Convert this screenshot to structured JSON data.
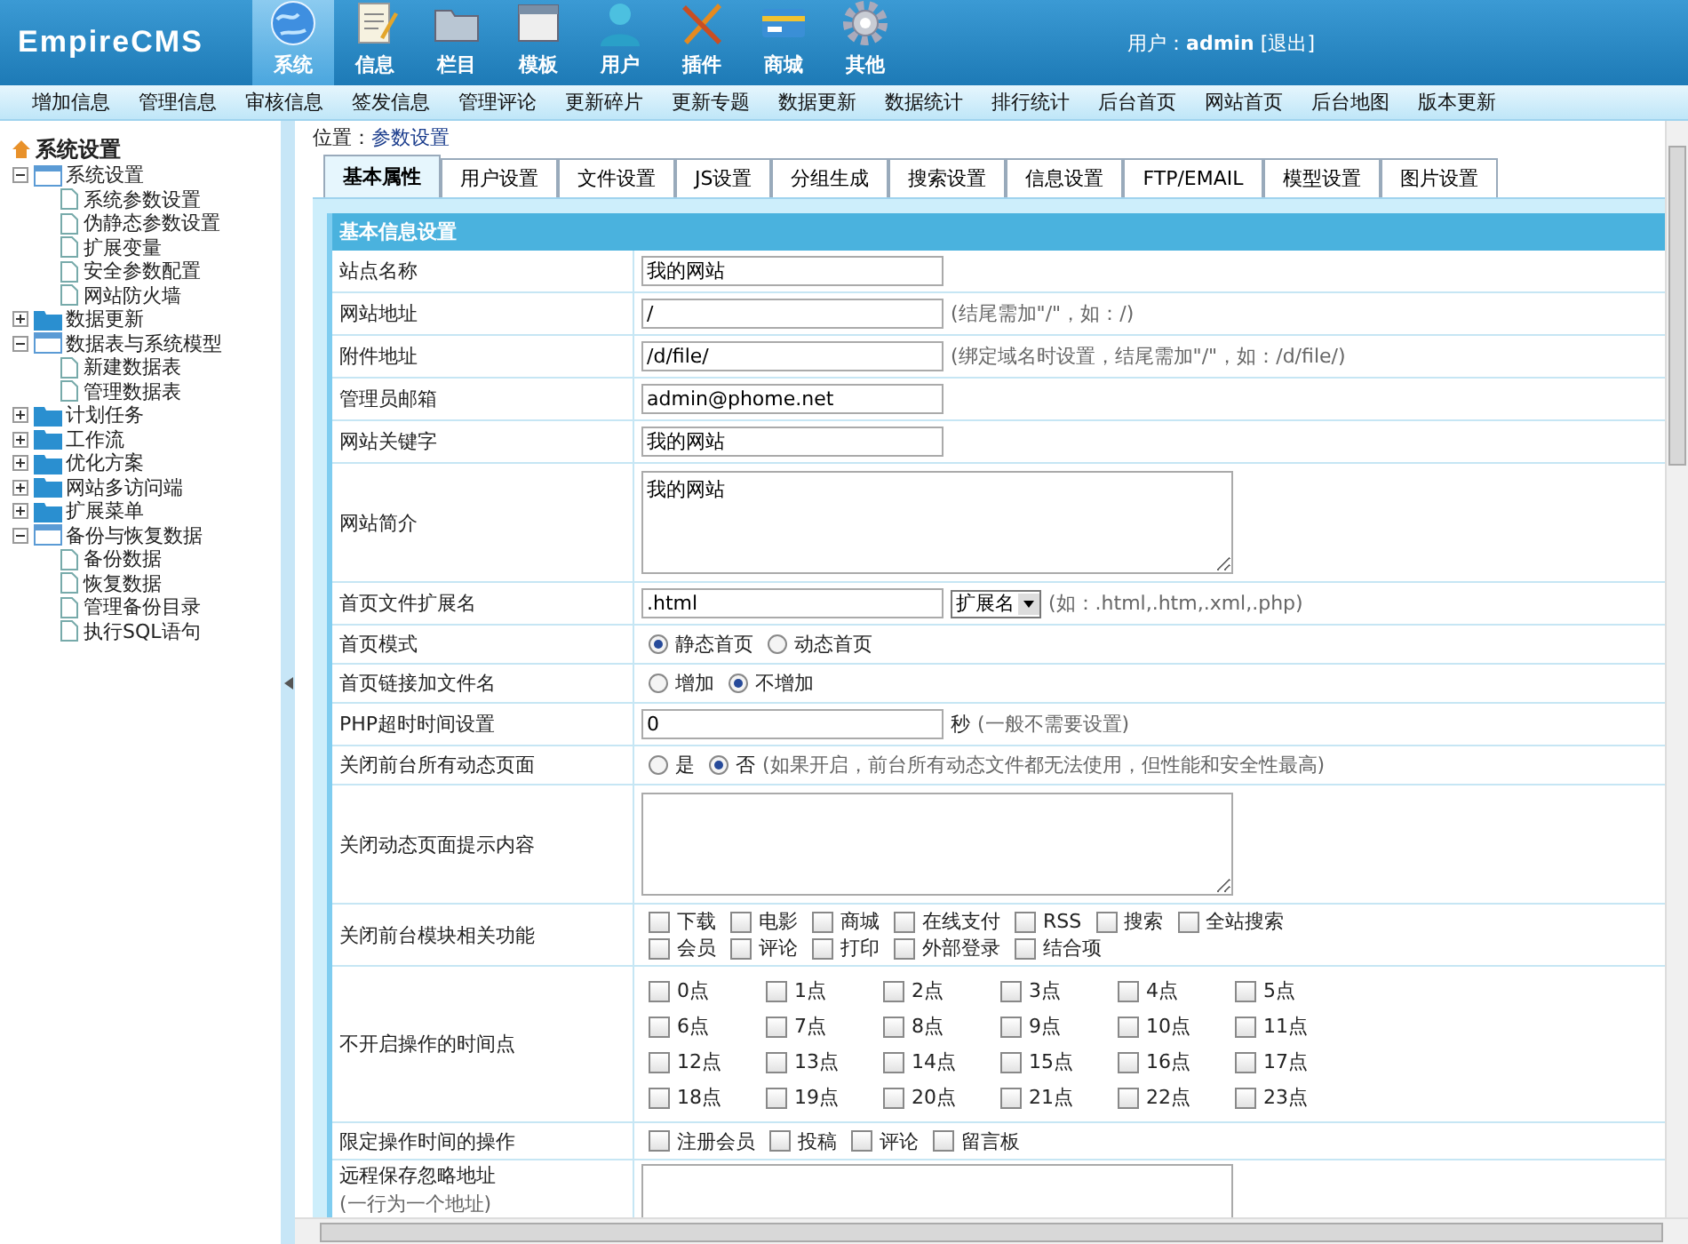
{
  "header": {
    "logo": "EmpireCMS",
    "nav": [
      {
        "label": "系统",
        "selected": true
      },
      {
        "label": "信息",
        "selected": false
      },
      {
        "label": "栏目",
        "selected": false
      },
      {
        "label": "模板",
        "selected": false
      },
      {
        "label": "用户",
        "selected": false
      },
      {
        "label": "插件",
        "selected": false
      },
      {
        "label": "商城",
        "selected": false
      },
      {
        "label": "其他",
        "selected": false
      }
    ],
    "user_label": "用户：",
    "user_name": "admin",
    "logout": "[退出]"
  },
  "subnav": [
    "增加信息",
    "管理信息",
    "审核信息",
    "签发信息",
    "管理评论",
    "更新碎片",
    "更新专题",
    "数据更新",
    "数据统计",
    "排行统计",
    "后台首页",
    "网站首页",
    "后台地图",
    "版本更新"
  ],
  "sidebar": {
    "title": "系统设置",
    "items": [
      {
        "label": "系统设置",
        "expanded": true,
        "children": [
          {
            "label": "系统参数设置"
          },
          {
            "label": "伪静态参数设置"
          },
          {
            "label": "扩展变量"
          },
          {
            "label": "安全参数配置"
          },
          {
            "label": "网站防火墙"
          }
        ]
      },
      {
        "label": "数据更新",
        "expanded": false
      },
      {
        "label": "数据表与系统模型",
        "expanded": true,
        "children": [
          {
            "label": "新建数据表"
          },
          {
            "label": "管理数据表"
          }
        ]
      },
      {
        "label": "计划任务",
        "expanded": false
      },
      {
        "label": "工作流",
        "expanded": false
      },
      {
        "label": "优化方案",
        "expanded": false
      },
      {
        "label": "网站多访问端",
        "expanded": false
      },
      {
        "label": "扩展菜单",
        "expanded": false
      },
      {
        "label": "备份与恢复数据",
        "expanded": true,
        "children": [
          {
            "label": "备份数据"
          },
          {
            "label": "恢复数据"
          },
          {
            "label": "管理备份目录"
          },
          {
            "label": "执行SQL语句"
          }
        ]
      }
    ]
  },
  "breadcrumb": {
    "label": "位置：",
    "link": "参数设置"
  },
  "tabs": [
    {
      "label": "基本属性",
      "selected": true
    },
    {
      "label": "用户设置",
      "selected": false
    },
    {
      "label": "文件设置",
      "selected": false
    },
    {
      "label": "JS设置",
      "selected": false
    },
    {
      "label": "分组生成",
      "selected": false
    },
    {
      "label": "搜索设置",
      "selected": false
    },
    {
      "label": "信息设置",
      "selected": false
    },
    {
      "label": "FTP/EMAIL",
      "selected": false
    },
    {
      "label": "模型设置",
      "selected": false
    },
    {
      "label": "图片设置",
      "selected": false
    }
  ],
  "form": {
    "title": "基本信息设置",
    "rows": [
      {
        "kind": "text",
        "label": "站点名称",
        "value": "我的网站"
      },
      {
        "kind": "text",
        "label": "网站地址",
        "value": "/",
        "hint": "(结尾需加\"/\"，如：/)"
      },
      {
        "kind": "text",
        "label": "附件地址",
        "value": "/d/file/",
        "hint": "(绑定域名时设置，结尾需加\"/\"，如：/d/file/)"
      },
      {
        "kind": "text",
        "label": "管理员邮箱",
        "value": "admin@phome.net"
      },
      {
        "kind": "text",
        "label": "网站关键字",
        "value": "我的网站"
      },
      {
        "kind": "textarea",
        "label": "网站简介",
        "value": "我的网站"
      },
      {
        "kind": "text",
        "label": "首页文件扩展名",
        "value": ".html",
        "dropdown": "扩展名",
        "hint": "(如：.html,.htm,.xml,.php)"
      },
      {
        "kind": "radio",
        "label": "首页模式",
        "options": [
          {
            "label": "静态首页",
            "selected": true
          },
          {
            "label": "动态首页",
            "selected": false
          }
        ]
      },
      {
        "kind": "radio",
        "label": "首页链接加文件名",
        "options": [
          {
            "label": "增加",
            "selected": false
          },
          {
            "label": "不增加",
            "selected": true
          }
        ]
      },
      {
        "kind": "text",
        "label": "PHP超时时间设置",
        "value": "0",
        "unit": "秒",
        "hint": "(一般不需要设置)"
      },
      {
        "kind": "radio",
        "label": "关闭前台所有动态页面",
        "options": [
          {
            "label": "是",
            "selected": false
          },
          {
            "label": "否",
            "selected": true
          }
        ],
        "hint": "(如果开启，前台所有动态文件都无法使用，但性能和安全性最高)"
      },
      {
        "kind": "textarea",
        "label": "关闭动态页面提示内容"
      },
      {
        "kind": "checks",
        "label": "关闭前台模块相关功能",
        "lines": [
          [
            {
              "label": "下载",
              "checked": false
            },
            {
              "label": "电影",
              "checked": false
            },
            {
              "label": "商城",
              "checked": false
            },
            {
              "label": "在线支付",
              "checked": false
            },
            {
              "label": "RSS",
              "checked": false
            },
            {
              "label": "搜索",
              "checked": false
            },
            {
              "label": "全站搜索",
              "checked": false
            }
          ],
          [
            {
              "label": "会员",
              "checked": false
            },
            {
              "label": "评论",
              "checked": false
            },
            {
              "label": "打印",
              "checked": false
            },
            {
              "label": "外部登录",
              "checked": false
            },
            {
              "label": "结合项",
              "checked": false
            }
          ]
        ]
      },
      {
        "kind": "grid",
        "label": "不开启操作的时间点",
        "options": [
          {
            "label": "0点",
            "checked": false
          },
          {
            "label": "1点",
            "checked": false
          },
          {
            "label": "2点",
            "checked": false
          },
          {
            "label": "3点",
            "checked": false
          },
          {
            "label": "4点",
            "checked": false
          },
          {
            "label": "5点",
            "checked": false
          },
          {
            "label": "6点",
            "checked": false
          },
          {
            "label": "7点",
            "checked": false
          },
          {
            "label": "8点",
            "checked": false
          },
          {
            "label": "9点",
            "checked": false
          },
          {
            "label": "10点",
            "checked": false
          },
          {
            "label": "11点",
            "checked": false
          },
          {
            "label": "12点",
            "checked": false
          },
          {
            "label": "13点",
            "checked": false
          },
          {
            "label": "14点",
            "checked": false
          },
          {
            "label": "15点",
            "checked": false
          },
          {
            "label": "16点",
            "checked": false
          },
          {
            "label": "17点",
            "checked": false
          },
          {
            "label": "18点",
            "checked": false
          },
          {
            "label": "19点",
            "checked": false
          },
          {
            "label": "20点",
            "checked": false
          },
          {
            "label": "21点",
            "checked": false
          },
          {
            "label": "22点",
            "checked": false
          },
          {
            "label": "23点",
            "checked": false
          }
        ]
      },
      {
        "kind": "checks",
        "label": "限定操作时间的操作",
        "lines": [
          [
            {
              "label": "注册会员",
              "checked": false
            },
            {
              "label": "投稿",
              "checked": false
            },
            {
              "label": "评论",
              "checked": false
            },
            {
              "label": "留言板",
              "checked": false
            }
          ]
        ]
      },
      {
        "kind": "textarea",
        "label": "远程保存忽略地址",
        "note": "(一行为一个地址)"
      }
    ]
  }
}
